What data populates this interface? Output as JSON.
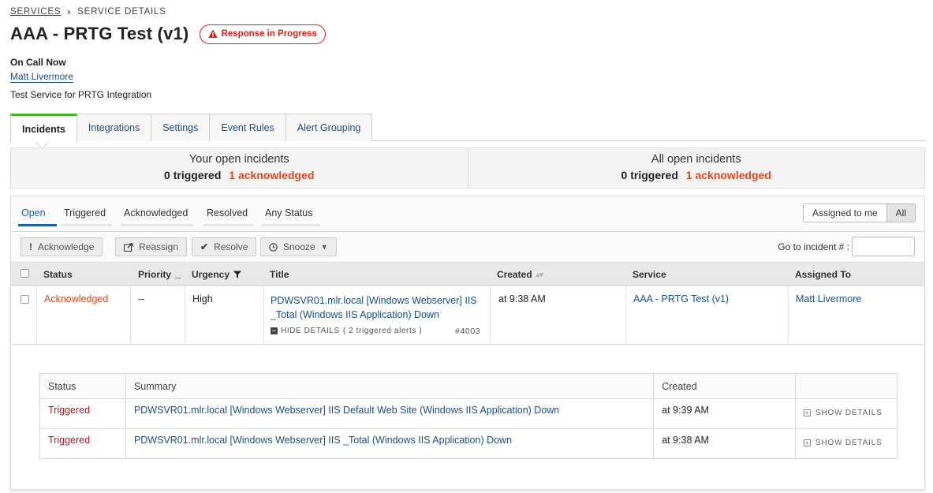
{
  "breadcrumb": {
    "root": "SERVICES",
    "current": "SERVICE DETAILS"
  },
  "service": {
    "title": "AAA - PRTG Test (v1)",
    "status_badge": "Response in Progress",
    "oncall_label": "On Call Now",
    "oncall_user": "Matt Livermore",
    "description": "Test Service for PRTG Integration"
  },
  "tabs": [
    "Incidents",
    "Integrations",
    "Settings",
    "Event Rules",
    "Alert Grouping"
  ],
  "summary": {
    "yours": {
      "heading": "Your open incidents",
      "triggered": "0 triggered",
      "acknowledged": "1 acknowledged"
    },
    "all": {
      "heading": "All open incidents",
      "triggered": "0 triggered",
      "acknowledged": "1 acknowledged"
    }
  },
  "filters": [
    "Open",
    "Triggered",
    "Acknowledged",
    "Resolved",
    "Any Status"
  ],
  "assign_toggle": {
    "me": "Assigned to me",
    "all": "All"
  },
  "actions": {
    "acknowledge": "Acknowledge",
    "reassign": "Reassign",
    "resolve": "Resolve",
    "snooze": "Snooze"
  },
  "goto_label": "Go to incident # :",
  "columns": {
    "status": "Status",
    "priority": "Priority",
    "urgency": "Urgency",
    "title": "Title",
    "created": "Created",
    "service": "Service",
    "assigned": "Assigned To"
  },
  "incident": {
    "status": "Acknowledged",
    "priority": "--",
    "urgency": "High",
    "title": "PDWSVR01.mlr.local [Windows Webserver] IIS _Total (Windows IIS Application) Down",
    "hide_details": "HIDE DETAILS",
    "alerts_note": "( 2 triggered alerts )",
    "number": "#4003",
    "created": "at 9:38 AM",
    "service": "AAA - PRTG Test (v1)",
    "assigned_to": "Matt Livermore"
  },
  "alerts_table": {
    "headers": {
      "status": "Status",
      "summary": "Summary",
      "created": "Created"
    },
    "show_details": "SHOW DETAILS",
    "rows": [
      {
        "status": "Triggered",
        "summary": "PDWSVR01.mlr.local [Windows Webserver] IIS Default Web Site (Windows IIS Application) Down",
        "created": "at 9:39 AM"
      },
      {
        "status": "Triggered",
        "summary": "PDWSVR01.mlr.local [Windows Webserver] IIS _Total (Windows IIS Application) Down",
        "created": "at 9:38 AM"
      }
    ]
  },
  "colors": {
    "accent": "#1a4f8b",
    "alert": "#d9261c",
    "acknowledged": "#e2471d",
    "triggered": "#b8141b",
    "tab_active": "#46b51f"
  }
}
